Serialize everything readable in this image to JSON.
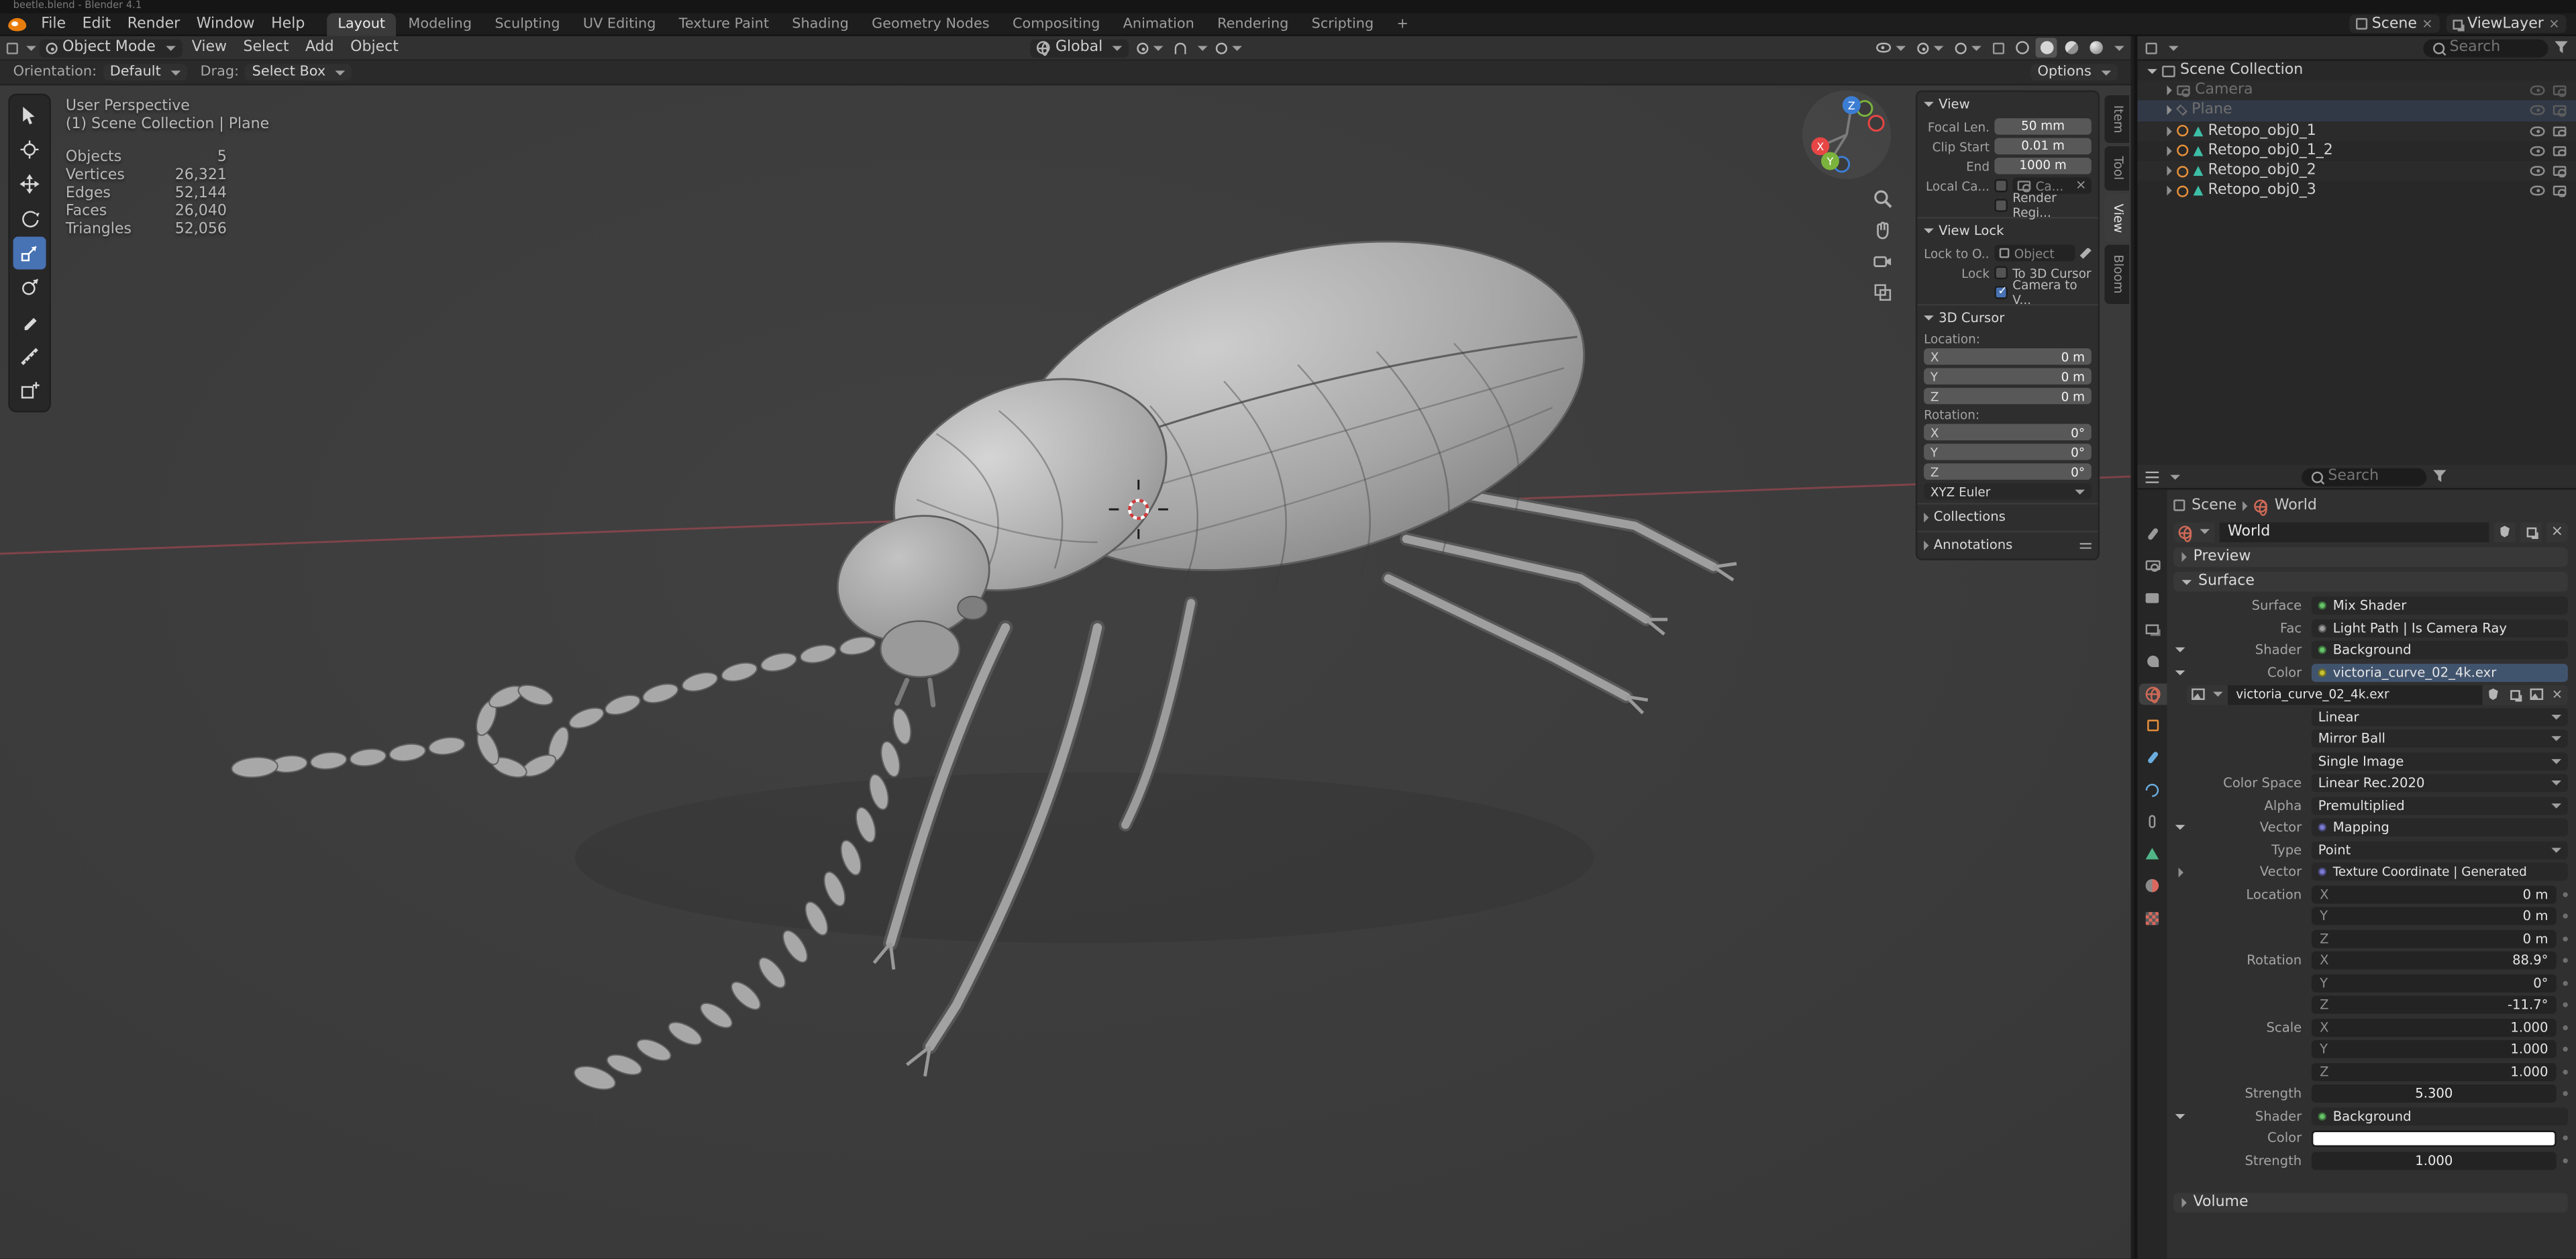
{
  "colors": {
    "accent_blue": "#4772b3",
    "object_orange": "#e8913a",
    "mesh_data_teal": "#3dbfa6",
    "world_red": "#d06a57",
    "axis_x_red": "#e84545",
    "axis_y_green": "#7bb33d",
    "axis_z_blue": "#3c7dd4"
  },
  "window": {
    "title": "beetle.blend - Blender 4.1"
  },
  "topbar": {
    "menus": [
      "File",
      "Edit",
      "Render",
      "Window",
      "Help"
    ],
    "workspaces": [
      "Layout",
      "Modeling",
      "Sculpting",
      "UV Editing",
      "Texture Paint",
      "Shading",
      "Geometry Nodes",
      "Compositing",
      "Animation",
      "Rendering",
      "Scripting"
    ],
    "add_workspace": "+",
    "scene_label": "Scene",
    "view_layer_label": "ViewLayer"
  },
  "viewport_header": {
    "mode": "Object Mode",
    "menus": [
      "View",
      "Select",
      "Add",
      "Object"
    ],
    "orientation": "Global"
  },
  "tool_settings": {
    "orientation_label": "Orientation:",
    "orientation_value": "Default",
    "drag_label": "Drag:",
    "drag_value": "Select Box",
    "options_label": "Options"
  },
  "viewport": {
    "perspective_label": "User Perspective",
    "context_label": "(1) Scene Collection | Plane",
    "stats": [
      {
        "label": "Objects",
        "value": "5"
      },
      {
        "label": "Vertices",
        "value": "26,321"
      },
      {
        "label": "Edges",
        "value": "52,144"
      },
      {
        "label": "Faces",
        "value": "26,040"
      },
      {
        "label": "Triangles",
        "value": "52,056"
      }
    ],
    "gizmo": {
      "x": "X",
      "y": "Y",
      "z": "Z"
    }
  },
  "sidebar_tabs": [
    {
      "label": "Item"
    },
    {
      "label": "Tool"
    },
    {
      "label": "View"
    },
    {
      "label": "Bloom"
    }
  ],
  "n_panel": {
    "view": {
      "title": "View",
      "focal_label": "Focal Len.",
      "focal_value": "50 mm",
      "clip_start_label": "Clip Start",
      "clip_start_value": "0.01 m",
      "clip_end_label": "End",
      "clip_end_value": "1000 m",
      "local_camera_label": "Local Ca...",
      "local_camera_value": "Ca...",
      "render_region_label": "Render Regi..."
    },
    "view_lock": {
      "title": "View Lock",
      "lock_to_object_label": "Lock to O...",
      "lock_to_object_placeholder": "Object",
      "lock_label": "Lock",
      "to_3d_cursor_label": "To 3D Cursor",
      "camera_to_view_label": "Camera to V..."
    },
    "cursor_3d": {
      "title": "3D Cursor",
      "location_label": "Location:",
      "rotation_label": "Rotation:",
      "location": [
        {
          "axis": "X",
          "value": "0 m"
        },
        {
          "axis": "Y",
          "value": "0 m"
        },
        {
          "axis": "Z",
          "value": "0 m"
        }
      ],
      "rotation": [
        {
          "axis": "X",
          "value": "0°"
        },
        {
          "axis": "Y",
          "value": "0°"
        },
        {
          "axis": "Z",
          "value": "0°"
        }
      ],
      "euler_mode": "XYZ Euler"
    },
    "collections_title": "Collections",
    "annotations_title": "Annotations"
  },
  "outliner": {
    "search_placeholder": "Search",
    "root_label": "Scene Collection",
    "items": [
      {
        "name": "Camera"
      },
      {
        "name": "Plane"
      },
      {
        "name": "Retopo_obj0_1"
      },
      {
        "name": "Retopo_obj0_1_2"
      },
      {
        "name": "Retopo_obj0_2"
      },
      {
        "name": "Retopo_obj0_3"
      }
    ]
  },
  "properties": {
    "search_placeholder": "Search",
    "breadcrumb": {
      "scene": "Scene",
      "world": "World"
    },
    "world_datablock": "World",
    "panels": {
      "preview": "Preview",
      "surface": "Surface",
      "volume": "Volume"
    },
    "surface": {
      "surface_label": "Surface",
      "surface_value": "Mix Shader",
      "fac_label": "Fac",
      "fac_value": "Light Path | Is Camera Ray",
      "shader1_label": "Shader",
      "shader1_value": "Background",
      "color1_label": "Color",
      "color1_value": "victoria_curve_02_4k.exr",
      "image_name": "victoria_curve_02_4k.exr",
      "interpolation": "Linear",
      "projection": "Mirror Ball",
      "source": "Single Image",
      "color_space_label": "Color Space",
      "color_space_value": "Linear Rec.2020",
      "alpha_label": "Alpha",
      "alpha_value": "Premultiplied",
      "vector1_label": "Vector",
      "vector1_value": "Mapping",
      "type_label": "Type",
      "type_value": "Point",
      "vector2_label": "Vector",
      "vector2_value": "Texture Coordinate | Generated",
      "location_label": "Location",
      "location": [
        {
          "axis": "X",
          "value": "0 m"
        },
        {
          "axis": "Y",
          "value": "0 m"
        },
        {
          "axis": "Z",
          "value": "0 m"
        }
      ],
      "rotation_label": "Rotation",
      "rotation": [
        {
          "axis": "X",
          "value": "88.9°"
        },
        {
          "axis": "Y",
          "value": "0°"
        },
        {
          "axis": "Z",
          "value": "-11.7°"
        }
      ],
      "scale_label": "Scale",
      "scale": [
        {
          "axis": "X",
          "value": "1.000"
        },
        {
          "axis": "Y",
          "value": "1.000"
        },
        {
          "axis": "Z",
          "value": "1.000"
        }
      ],
      "strength1_label": "Strength",
      "strength1_value": "5.300",
      "shader2_label": "Shader",
      "shader2_value": "Background",
      "color2_label": "Color",
      "strength2_label": "Strength",
      "strength2_value": "1.000"
    }
  }
}
